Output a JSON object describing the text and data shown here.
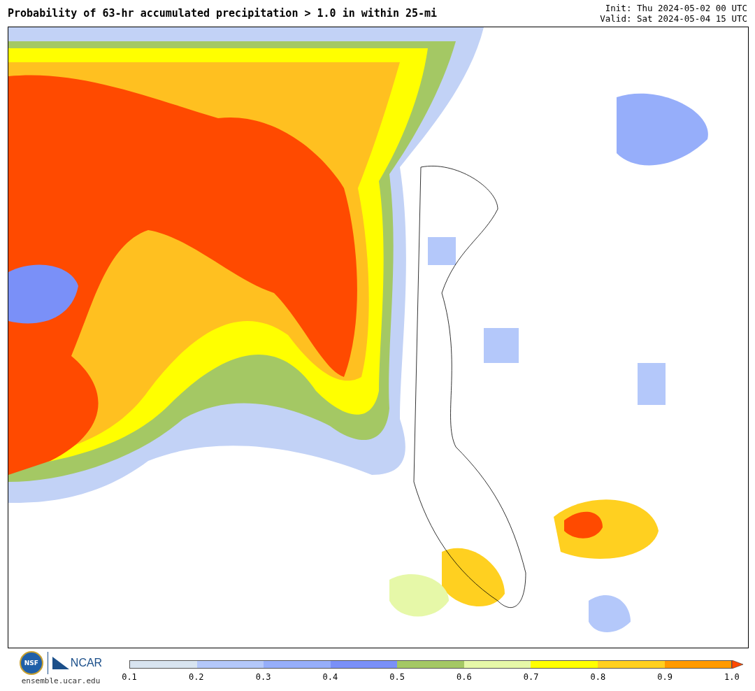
{
  "title": "Probability of 63-hr accumulated precipitation > 1.0 in within 25-mi",
  "init": "Init: Thu 2024-05-02 00 UTC",
  "valid": "Valid: Sat 2024-05-04 15 UTC",
  "logos": {
    "nsf": "NSF",
    "ncar": "NCAR",
    "site": "ensemble.ucar.edu"
  },
  "colorbar": {
    "bins": [
      {
        "color": "#d8e4f0"
      },
      {
        "color": "#b4c8fa"
      },
      {
        "color": "#96aefa"
      },
      {
        "color": "#7a90f8"
      },
      {
        "color": "#a4c864"
      },
      {
        "color": "#e6f8a8"
      },
      {
        "color": "#ffff00"
      },
      {
        "color": "#ffd020"
      },
      {
        "color": "#ff9a00"
      }
    ],
    "extend": {
      "color": "#ff4a00"
    },
    "ticks": [
      "0.1",
      "0.2",
      "0.3",
      "0.4",
      "0.5",
      "0.6",
      "0.7",
      "0.8",
      "0.9",
      "1.0"
    ]
  }
}
